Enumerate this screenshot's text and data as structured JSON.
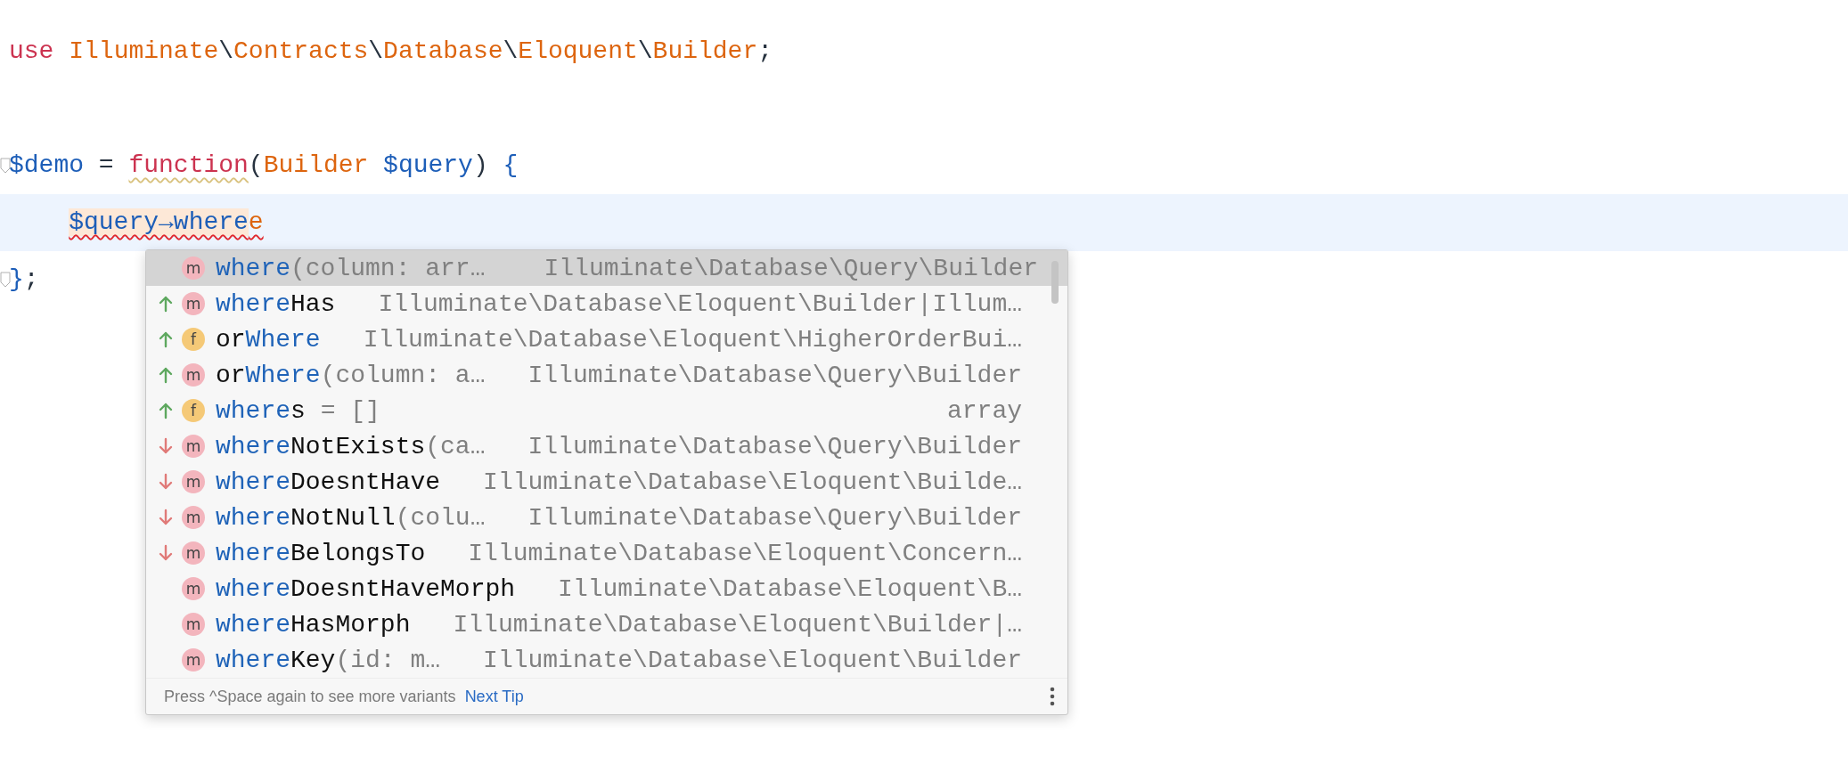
{
  "editor": {
    "lines": [
      {
        "current": false,
        "tokens": [
          {
            "text": "use ",
            "kind": "keyword"
          },
          {
            "text": "Illuminate",
            "kind": "namespace"
          },
          {
            "text": "\\",
            "kind": "punct"
          },
          {
            "text": "Contracts",
            "kind": "namespace"
          },
          {
            "text": "\\",
            "kind": "punct"
          },
          {
            "text": "Database",
            "kind": "namespace"
          },
          {
            "text": "\\",
            "kind": "punct"
          },
          {
            "text": "Eloquent",
            "kind": "namespace"
          },
          {
            "text": "\\",
            "kind": "punct"
          },
          {
            "text": "Builder",
            "kind": "namespace"
          },
          {
            "text": ";",
            "kind": "punct"
          }
        ]
      },
      {
        "current": false
      },
      {
        "current": false,
        "fold": true,
        "tokens": [
          {
            "text": "$demo",
            "kind": "variable"
          },
          {
            "text": " = ",
            "kind": "punct"
          },
          {
            "text": "function",
            "kind": "keyword",
            "warning": true
          },
          {
            "text": "(",
            "kind": "punct"
          },
          {
            "text": "Builder ",
            "kind": "namespace"
          },
          {
            "text": "$query",
            "kind": "variable"
          },
          {
            "text": ") ",
            "kind": "punct"
          },
          {
            "text": "{",
            "kind": "variable"
          }
        ]
      },
      {
        "current": true,
        "indented": true,
        "tokens": [
          {
            "text": "$query→where",
            "kind": "variable",
            "highlight": true,
            "error": true
          },
          {
            "text": "e",
            "kind": "namespace",
            "error": true
          }
        ]
      },
      {
        "current": false,
        "fold": true,
        "tokens": [
          {
            "text": "}",
            "kind": "variable"
          },
          {
            "text": ";",
            "kind": "punct"
          }
        ]
      }
    ]
  },
  "completion": {
    "items": [
      {
        "ranked_up": false,
        "ranked_down": false,
        "kind": "method",
        "badge": "m",
        "selected": true,
        "name": [
          {
            "text": "where",
            "kind": "match"
          },
          {
            "text": "(column: arr…",
            "kind": "params"
          }
        ],
        "type": "Illuminate\\Database\\Query\\Builder"
      },
      {
        "ranked_up": true,
        "ranked_down": false,
        "kind": "method",
        "badge": "m",
        "selected": false,
        "name": [
          {
            "text": "where",
            "kind": "match"
          },
          {
            "text": "Has",
            "kind": "plain"
          }
        ],
        "type": "Illuminate\\Database\\Eloquent\\Builder|Illum…"
      },
      {
        "ranked_up": true,
        "ranked_down": false,
        "kind": "field",
        "badge": "f",
        "selected": false,
        "name": [
          {
            "text": "or",
            "kind": "plain"
          },
          {
            "text": "Where",
            "kind": "match"
          }
        ],
        "type": "Illuminate\\Database\\Eloquent\\HigherOrderBui…"
      },
      {
        "ranked_up": true,
        "ranked_down": false,
        "kind": "method",
        "badge": "m",
        "selected": false,
        "name": [
          {
            "text": "or",
            "kind": "plain"
          },
          {
            "text": "Where",
            "kind": "match"
          },
          {
            "text": "(column: a…",
            "kind": "params"
          }
        ],
        "type": "Illuminate\\Database\\Query\\Builder"
      },
      {
        "ranked_up": true,
        "ranked_down": false,
        "kind": "field",
        "badge": "f",
        "selected": false,
        "name": [
          {
            "text": "where",
            "kind": "match"
          },
          {
            "text": "s",
            "kind": "plain"
          },
          {
            "text": " = []",
            "kind": "params"
          }
        ],
        "type": "array"
      },
      {
        "ranked_up": false,
        "ranked_down": true,
        "kind": "method",
        "badge": "m",
        "selected": false,
        "name": [
          {
            "text": "where",
            "kind": "match"
          },
          {
            "text": "NotExists",
            "kind": "plain"
          },
          {
            "text": "(ca…",
            "kind": "params"
          }
        ],
        "type": "Illuminate\\Database\\Query\\Builder"
      },
      {
        "ranked_up": false,
        "ranked_down": true,
        "kind": "method",
        "badge": "m",
        "selected": false,
        "name": [
          {
            "text": "where",
            "kind": "match"
          },
          {
            "text": "DoesntHave",
            "kind": "plain"
          }
        ],
        "type": "Illuminate\\Database\\Eloquent\\Builde…"
      },
      {
        "ranked_up": false,
        "ranked_down": true,
        "kind": "method",
        "badge": "m",
        "selected": false,
        "name": [
          {
            "text": "where",
            "kind": "match"
          },
          {
            "text": "NotNull",
            "kind": "plain"
          },
          {
            "text": "(colu…",
            "kind": "params"
          }
        ],
        "type": "Illuminate\\Database\\Query\\Builder"
      },
      {
        "ranked_up": false,
        "ranked_down": true,
        "kind": "method",
        "badge": "m",
        "selected": false,
        "name": [
          {
            "text": "where",
            "kind": "match"
          },
          {
            "text": "BelongsTo",
            "kind": "plain"
          }
        ],
        "type": "Illuminate\\Database\\Eloquent\\Concern…"
      },
      {
        "ranked_up": false,
        "ranked_down": false,
        "kind": "method",
        "badge": "m",
        "selected": false,
        "name": [
          {
            "text": "where",
            "kind": "match"
          },
          {
            "text": "DoesntHaveMorph",
            "kind": "plain"
          }
        ],
        "type": "Illuminate\\Database\\Eloquent\\B…"
      },
      {
        "ranked_up": false,
        "ranked_down": false,
        "kind": "method",
        "badge": "m",
        "selected": false,
        "name": [
          {
            "text": "where",
            "kind": "match"
          },
          {
            "text": "HasMorph",
            "kind": "plain"
          }
        ],
        "type": "Illuminate\\Database\\Eloquent\\Builder|…"
      },
      {
        "ranked_up": false,
        "ranked_down": false,
        "kind": "method",
        "badge": "m",
        "selected": false,
        "name": [
          {
            "text": "where",
            "kind": "match"
          },
          {
            "text": "Key",
            "kind": "plain"
          },
          {
            "text": "(id: m…",
            "kind": "params"
          }
        ],
        "type": "Illuminate\\Database\\Eloquent\\Builder"
      }
    ],
    "footer": {
      "hint": "Press ^Space again to see more variants",
      "link": "Next Tip"
    }
  }
}
